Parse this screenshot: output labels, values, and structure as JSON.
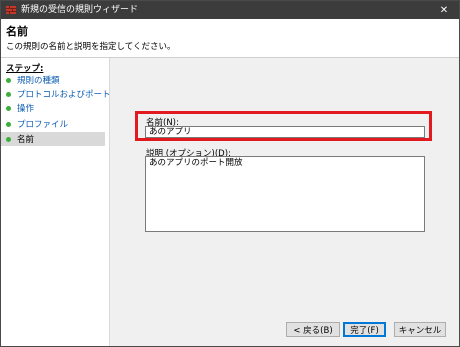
{
  "window": {
    "title": "新規の受信の規則ウィザード",
    "close_symbol": "✕"
  },
  "header": {
    "title": "名前",
    "description": "この規則の名前と説明を指定してください。"
  },
  "sidebar": {
    "steps_label": "ステップ:",
    "items": [
      {
        "label": "規則の種類"
      },
      {
        "label": "プロトコルおよびポート"
      },
      {
        "label": "操作"
      },
      {
        "label": "プロファイル"
      },
      {
        "label": "名前"
      }
    ],
    "selected_index": 4
  },
  "form": {
    "name_label": "名前(N):",
    "name_value": "あのアプリ",
    "description_label": "説明 (オプション)(D):",
    "description_value": "あのアプリのポート開放"
  },
  "buttons": {
    "back": "< 戻る(B)",
    "finish": "完了(F)",
    "cancel": "キャンセル"
  },
  "colors": {
    "titlebar": "#3c3c3c",
    "highlight_border": "#e2191f",
    "step_dot": "#3cae3c",
    "step_link": "#0a5bb5"
  }
}
